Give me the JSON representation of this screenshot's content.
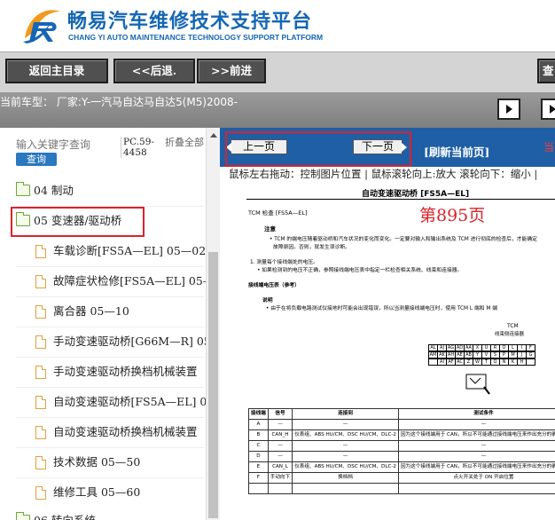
{
  "header": {
    "brand_cn": "畅易汽车维修技术支持平台",
    "brand_en": "CHANG YI AUTO MAINTENANCE TECHNOLOGY SUPPORT PLATFORM",
    "colors": {
      "brand_blue": "#1566b4",
      "logo_orange": "#f29a1f"
    }
  },
  "toolbar": {
    "home_label": "返回主目录",
    "back_label": "<<后退.",
    "forward_label": ">>前进",
    "right_label": "查"
  },
  "car_bar": {
    "text": "当前车型：  厂家:Y-一汽马自达马自达5(M5)2008-"
  },
  "left": {
    "search_placeholder": "输入关键字查询",
    "search_button": "查询",
    "pc_code": "PC.59-4458",
    "collapse_all": "折叠全部",
    "tree": [
      {
        "label": "04 制动",
        "type": "folder"
      },
      {
        "label": "05 变速器/驱动桥",
        "type": "folder-open",
        "selected": true
      },
      {
        "label": "车载诊断[FS5A—EL] 05—02",
        "type": "doc"
      },
      {
        "label": "故障症状检修[FS5A—EL] 05—",
        "type": "doc"
      },
      {
        "label": "离合器 05—10",
        "type": "doc"
      },
      {
        "label": "手动变速驱动桥[G66M—R] 05",
        "type": "doc"
      },
      {
        "label": "手动变速驱动桥换档机械装置",
        "type": "doc"
      },
      {
        "label": "自动变速驱动桥[FS5A—EL] 05",
        "type": "doc"
      },
      {
        "label": "自动变速驱动桥换档机械装置",
        "type": "doc"
      },
      {
        "label": "技术数据 05—50",
        "type": "doc"
      },
      {
        "label": "维修工具 05—60",
        "type": "doc"
      },
      {
        "label": "06 转向系统",
        "type": "folder"
      }
    ]
  },
  "right": {
    "prev_page": "上一页",
    "next_page": "下一页",
    "refresh": "[刷新当前页]",
    "when_text": "当",
    "hint": "鼠标左右拖动：控制图片位置 | 鼠标滚轮向上:放大  滚轮向下：缩小  |",
    "doc": {
      "title": "自动变速驱动桥 [FS5A—EL]",
      "page_number": "第895页",
      "tcm_check": "TCM 检查 [FS5A—EL]",
      "note_heading": "注意",
      "note_line1": "• TCM 的端电压随着驱动桥和汽车状况的变化而变化。一定要对输入和输出系统及 TCM 进行彻底的检查后，才能确定",
      "note_line2": "故障原因。否则，就发生误诊断。",
      "step1": "1. 测量每个接线端处的电压。",
      "step1_sub": "• 如果检测到的电压不正确，参照接线端电压表中指定一栏检查相关系统、线束和连接器。",
      "table_ref": "接线端电压表（参考）",
      "desc_heading": "说明",
      "desc_line": "• 由于在将负载电路测试仪接地时可能会出现错误，所以当测量接线端电压时，使用 TCM L 端和 M 端",
      "circuit_title": "TCM",
      "circuit_sub": "线束侧连接器",
      "circuit_rows": [
        [
          "AL",
          "AJ",
          "AG",
          "AD",
          "AA",
          "X",
          "U",
          "R",
          "O",
          "L",
          "I",
          "F"
        ],
        [
          "AM",
          "AK",
          "AH",
          "AE",
          "AB",
          "Y",
          "V",
          "S",
          "P",
          "M",
          "J",
          "G"
        ],
        [
          "",
          "AI",
          "AF",
          "AC",
          "Z",
          "W",
          "T",
          "Q",
          "N",
          "K",
          "H",
          ""
        ]
      ],
      "table_headers": [
        "接线端",
        "信号",
        "连接到",
        "测试条件",
        "电压（V）",
        "检查项目"
      ],
      "table_rows": [
        [
          "A",
          "—",
          "—",
          "—",
          "—",
          "—"
        ],
        [
          "B",
          "CAN_H",
          "仪表组、ABS HU/CM、DSC HU/CM、DLC-2",
          "因为这个接线端用于 CAN，所以不可能通过接线端电压来作出充分的确定。",
          "—",
          "—"
        ],
        [
          "C",
          "—",
          "—",
          "—",
          "—",
          "—"
        ],
        [
          "D",
          "—",
          "—",
          "—",
          "—",
          "—"
        ],
        [
          "E",
          "CAN_L",
          "仪表组、ABS HU/CM、DSC HU/CM、DLC-2",
          "因为这个接线端用于 CAN，所以不可能通过接线端电压来作出充分的确定。",
          "—",
          "—"
        ],
        [
          "F",
          "手动向下",
          "换档档",
          "点火开关处于 ON 开启位置",
          "检测选档杆在 M 档位置换档档的操作",
          "低于 1.0"
        ],
        [
          "",
          "",
          "",
          "",
          "其他",
          "B+"
        ]
      ]
    }
  }
}
